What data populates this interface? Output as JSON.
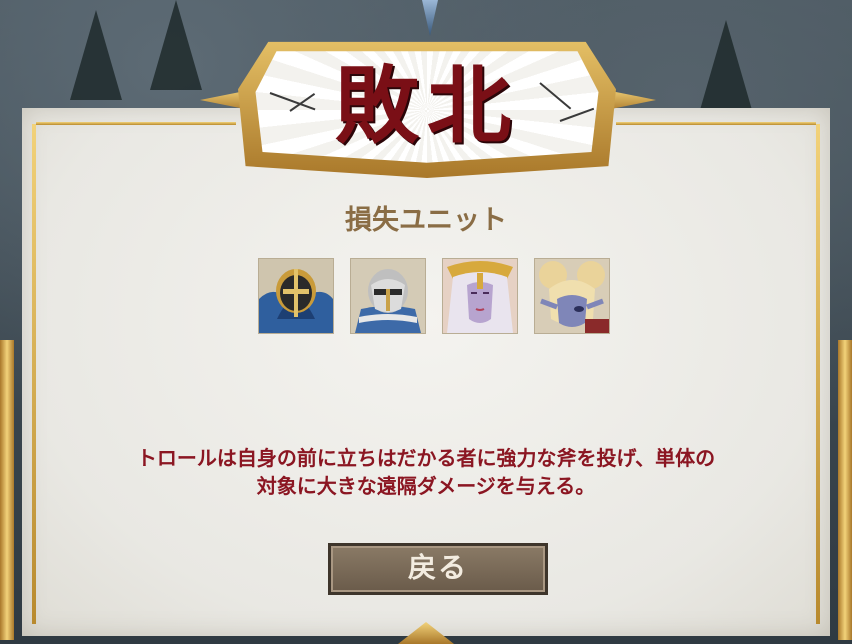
{
  "dialog": {
    "title": "敗北",
    "subtitle": "損失ユニット",
    "description_line1": "トロールは自身の前に立ちはだかる者に強力な斧を投げ、単体の",
    "description_line2": "対象に大きな遠隔ダメージを与える。",
    "back_button_label": "戻る"
  },
  "lost_units": [
    {
      "icon": "blue-armored-knight-portrait"
    },
    {
      "icon": "white-armored-knight-portrait"
    },
    {
      "icon": "white-haired-priestess-portrait"
    },
    {
      "icon": "blonde-pigtail-yordle-portrait"
    }
  ],
  "colors": {
    "title": "#7a0f16",
    "subtitle": "#8a6d45",
    "description": "#8b1622",
    "gold": "#d9ad4f",
    "button": "#7a6b59"
  }
}
